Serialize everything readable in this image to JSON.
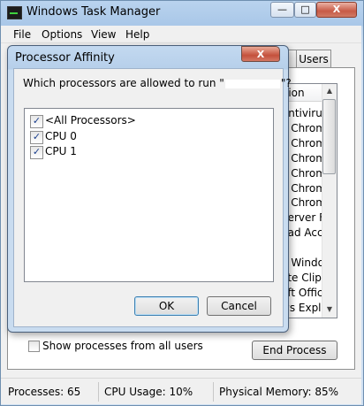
{
  "task_manager": {
    "title": "Windows Task Manager",
    "caption_buttons": {
      "minimize": "—",
      "maximize": "□",
      "close": "X"
    },
    "menu": [
      "File",
      "Options",
      "View",
      "Help"
    ],
    "tab_users": "Users",
    "column_header": "ption",
    "rows": [
      "Antiviru",
      "e Chrom",
      "e Chrom",
      "e Chrom",
      "e Chrom",
      "e Chrom",
      "e Chrom",
      "Server F",
      "bad Acc",
      "",
      "p Windo",
      "ote Clipp",
      "oft Offic",
      "ws Explo"
    ],
    "show_all_users_label": "Show processes from all users",
    "end_process_label": "End Process",
    "status": {
      "processes": "Processes: 65",
      "cpu_usage": "CPU Usage: 10%",
      "physical_memory": "Physical Memory: 85%"
    }
  },
  "dialog": {
    "title": "Processor Affinity",
    "close_glyph": "X",
    "question_prefix": "Which processors are allowed to run \"",
    "question_suffix": "\"?",
    "items": [
      {
        "label": "<All Processors>",
        "checked": true
      },
      {
        "label": "CPU 0",
        "checked": true
      },
      {
        "label": "CPU 1",
        "checked": true
      }
    ],
    "ok_label": "OK",
    "cancel_label": "Cancel"
  }
}
